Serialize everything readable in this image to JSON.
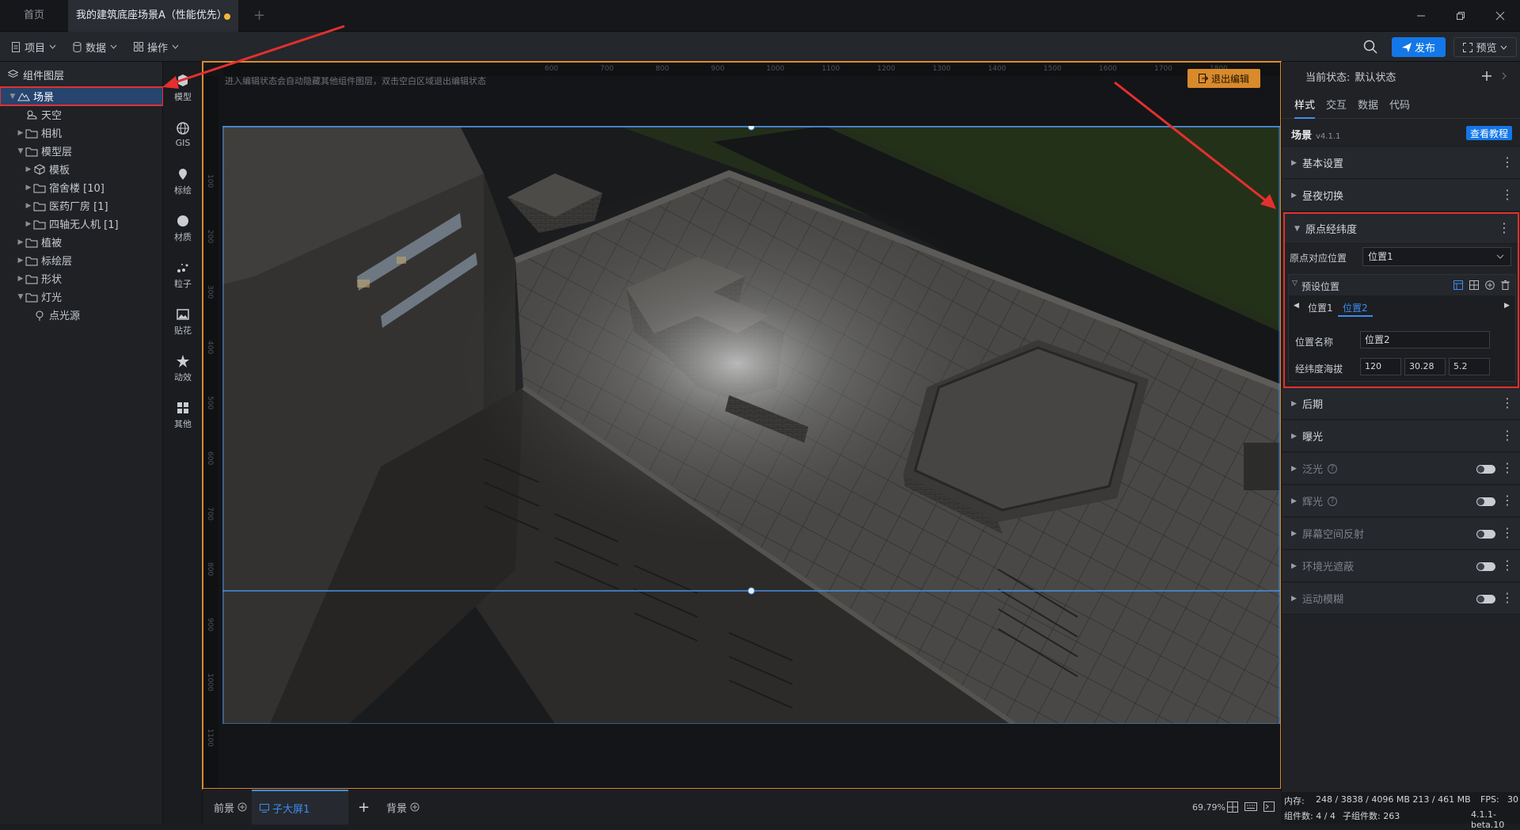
{
  "tabs": {
    "home": "首页",
    "active": "我的建筑底座场景A（性能优先）",
    "add": "+"
  },
  "toolbar": {
    "project": "项目",
    "data": "数据",
    "ops": "操作",
    "publish": "发布",
    "preview": "预览"
  },
  "layers": {
    "title": "组件图层",
    "items": [
      {
        "label": "场景",
        "depth": 0,
        "arrow": "▼",
        "icon": "scene"
      },
      {
        "label": "天空",
        "depth": 1,
        "arrow": "",
        "icon": "sky"
      },
      {
        "label": "相机",
        "depth": 1,
        "arrow": "▶",
        "icon": "folder"
      },
      {
        "label": "模型层",
        "depth": 1,
        "arrow": "▼",
        "icon": "folder"
      },
      {
        "label": "模板",
        "depth": 2,
        "arrow": "▶",
        "icon": "cube"
      },
      {
        "label": "宿舍楼 [10]",
        "depth": 2,
        "arrow": "▶",
        "icon": "folder"
      },
      {
        "label": "医药厂房 [1]",
        "depth": 2,
        "arrow": "▶",
        "icon": "folder"
      },
      {
        "label": "四轴无人机 [1]",
        "depth": 2,
        "arrow": "▶",
        "icon": "folder"
      },
      {
        "label": "植被",
        "depth": 1,
        "arrow": "▶",
        "icon": "folder"
      },
      {
        "label": "标绘层",
        "depth": 1,
        "arrow": "▶",
        "icon": "folder"
      },
      {
        "label": "形状",
        "depth": 1,
        "arrow": "▶",
        "icon": "folder"
      },
      {
        "label": "灯光",
        "depth": 1,
        "arrow": "▼",
        "icon": "folder"
      },
      {
        "label": "点光源",
        "depth": 2,
        "arrow": "",
        "icon": "pin"
      }
    ]
  },
  "iconbar": [
    {
      "label": "模型",
      "icon": "model-icon"
    },
    {
      "label": "GIS",
      "icon": "globe-icon"
    },
    {
      "label": "标绘",
      "icon": "marker-icon"
    },
    {
      "label": "材质",
      "icon": "sphere-icon"
    },
    {
      "label": "粒子",
      "icon": "particle-icon"
    },
    {
      "label": "贴花",
      "icon": "image-icon"
    },
    {
      "label": "动效",
      "icon": "star-icon"
    },
    {
      "label": "其他",
      "icon": "grid-icon"
    }
  ],
  "canvas": {
    "hint": "进入编辑状态会自动隐藏其他组件图层，双击空白区域退出编辑状态",
    "exit_edit": "退出编辑",
    "ruler_top": [
      "600",
      "700",
      "800",
      "900",
      "1000",
      "1100",
      "1200",
      "1300",
      "1400",
      "1500",
      "1600",
      "1700",
      "1800"
    ],
    "ruler_left": [
      "100",
      "200",
      "300",
      "400",
      "500",
      "600",
      "700",
      "800",
      "900",
      "1000",
      "1100"
    ]
  },
  "footer": {
    "front": "前景",
    "subscreen": "子大屏1",
    "add": "+",
    "back": "背景",
    "zoom": "69.79%"
  },
  "right": {
    "state_label": "当前状态:",
    "state_value": "默认状态",
    "tabs": [
      "样式",
      "交互",
      "数据",
      "代码"
    ],
    "scene_name": "场景",
    "scene_version": "v4.1.1",
    "tutorial": "查看教程",
    "sec_basic": "基本设置",
    "sec_daynight": "昼夜切换",
    "sec_origin": "原点经纬度",
    "origin_pos_label": "原点对应位置",
    "origin_pos_value": "位置1",
    "preset_label": "预设位置",
    "preset_tab1": "位置1",
    "preset_tab2": "位置2",
    "pos_name_label": "位置名称",
    "pos_name_value": "位置2",
    "lonlat_label": "经纬度海拔",
    "lon": "120",
    "lat": "30.28",
    "alt": "5.2",
    "sec_post": "后期",
    "sec_exposure": "曝光",
    "sec_bloom": "泛光",
    "sec_glow": "辉光",
    "sec_ssr": "屏幕空间反射",
    "sec_ao": "环境光遮蔽",
    "sec_motion": "运动模糊"
  },
  "status": {
    "mem": "内存:",
    "mem_value": "248 / 3838 / 4096 MB  213 / 461 MB",
    "fps": "FPS:",
    "fps_value": "30",
    "comp": "组件数: 4 / 4",
    "subcomp": "子组件数: 263",
    "version": "4.1.1-beta.10"
  },
  "colors": {
    "accent": "#1377e8",
    "edit_frame": "#d98a2b",
    "highlight": "#e3302e"
  }
}
